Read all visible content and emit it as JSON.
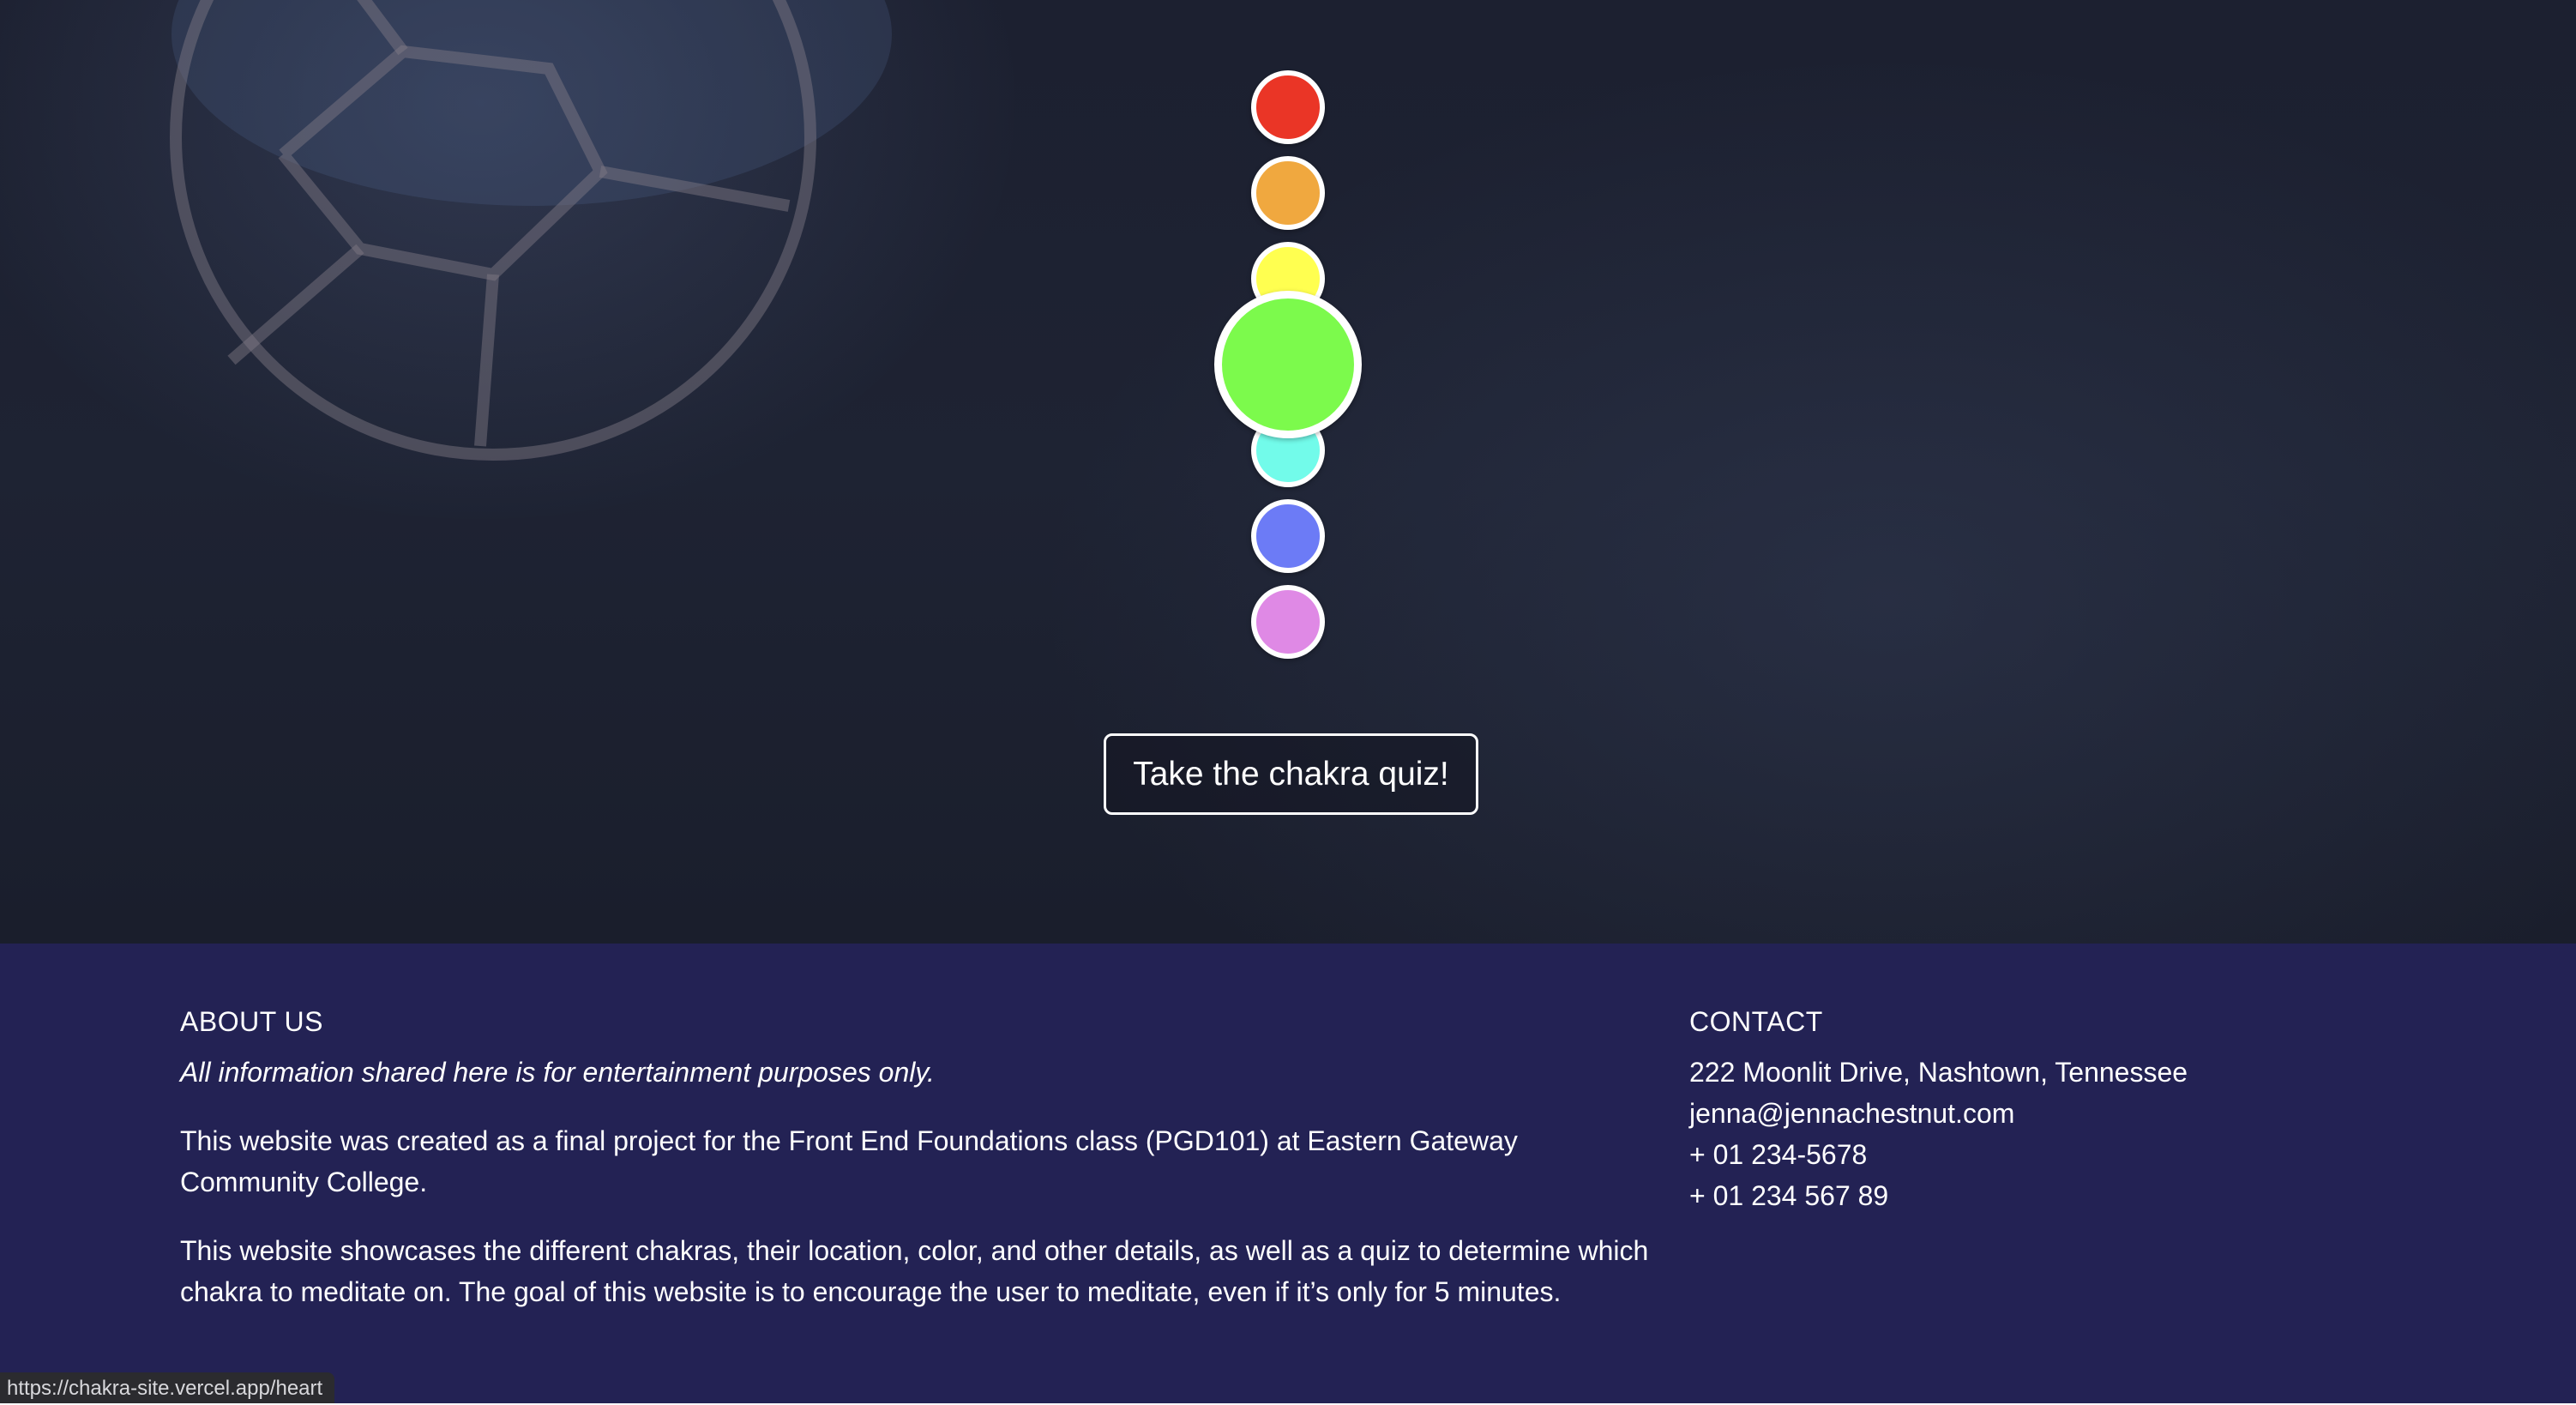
{
  "chakras": [
    {
      "id": "root",
      "color": "#ea3526",
      "active": false
    },
    {
      "id": "sacral",
      "color": "#f0a83f",
      "active": false
    },
    {
      "id": "solar-plexus",
      "color": "#ffff50",
      "active": false
    },
    {
      "id": "heart",
      "color": "#7cfa4c",
      "active": true
    },
    {
      "id": "throat",
      "color": "#72fbea",
      "active": false
    },
    {
      "id": "third-eye",
      "color": "#6c7bf6",
      "active": false
    },
    {
      "id": "crown",
      "color": "#df89e5",
      "active": false
    }
  ],
  "quiz": {
    "label": "Take the chakra quiz!"
  },
  "footer": {
    "about": {
      "heading": "ABOUT US",
      "disclaimer": "All information shared here is for entertainment purposes only.",
      "paragraph1": "This website was created as a final project for the Front End Foundations class (PGD101) at Eastern Gateway Community College.",
      "paragraph2": "This website showcases the different chakras, their location, color, and other details, as well as a quiz to determine which chakra to meditate on. The goal of this website is to encourage the user to meditate, even if it’s only for 5 minutes."
    },
    "contact": {
      "heading": "CONTACT",
      "address": "222 Moonlit Drive, Nashtown, Tennessee",
      "email": "jenna@jennachestnut.com",
      "phone1": "+ 01 234-5678",
      "phone2": "+ 01 234 567 89"
    }
  },
  "status_bar": {
    "url": "https://chakra-site.vercel.app/heart"
  },
  "colors": {
    "footer_bg": "#232254",
    "hero_bg": "#1e2333"
  }
}
